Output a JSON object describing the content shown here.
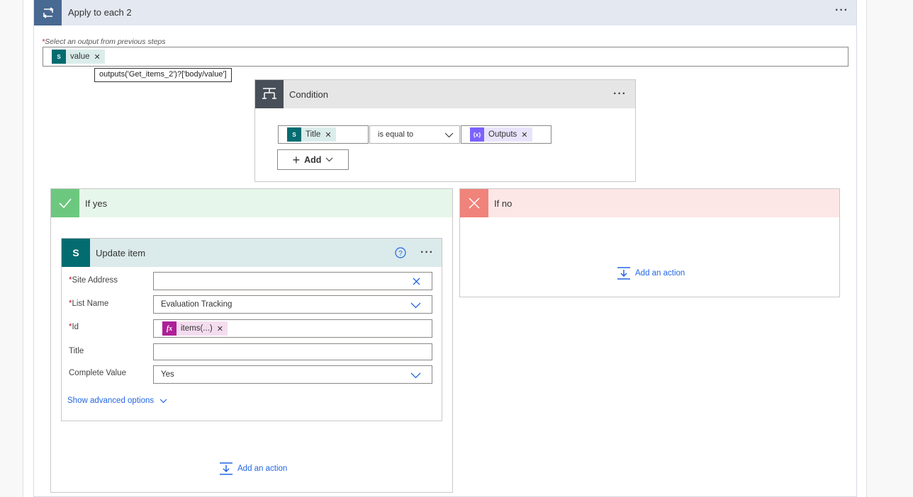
{
  "loop": {
    "title": "Apply to each 2",
    "select_label": "Select an output from previous steps",
    "token_label": "value",
    "tooltip": "outputs('Get_items_2')?['body/value']"
  },
  "condition": {
    "title": "Condition",
    "left_token": "Title",
    "operator": "is equal to",
    "right_token": "Outputs",
    "add_label": "Add"
  },
  "if_yes": {
    "title": "If yes",
    "add_action": "Add an action",
    "update_item": {
      "title": "Update item",
      "fields": {
        "site_address_label": "Site Address",
        "site_address_value": "",
        "list_name_label": "List Name",
        "list_name_value": "Evaluation Tracking",
        "id_label": "Id",
        "id_token": "items(...)",
        "title_label": "Title",
        "title_value": "",
        "complete_value_label": "Complete Value",
        "complete_value_value": "Yes"
      },
      "advanced": "Show advanced options"
    }
  },
  "if_no": {
    "title": "If no",
    "add_action": "Add an action"
  },
  "colors": {
    "loop_header": "#e3e8f1",
    "loop_icon": "#486991",
    "condition_icon": "#484f58",
    "yes_header": "#e7f6ea",
    "yes_icon": "#6dc87f",
    "no_header": "#fde7e6",
    "no_icon": "#f0837a",
    "sharepoint": "#036c70",
    "variable": "#7b61ff",
    "expression": "#ad1f97",
    "link": "#2266e3"
  }
}
